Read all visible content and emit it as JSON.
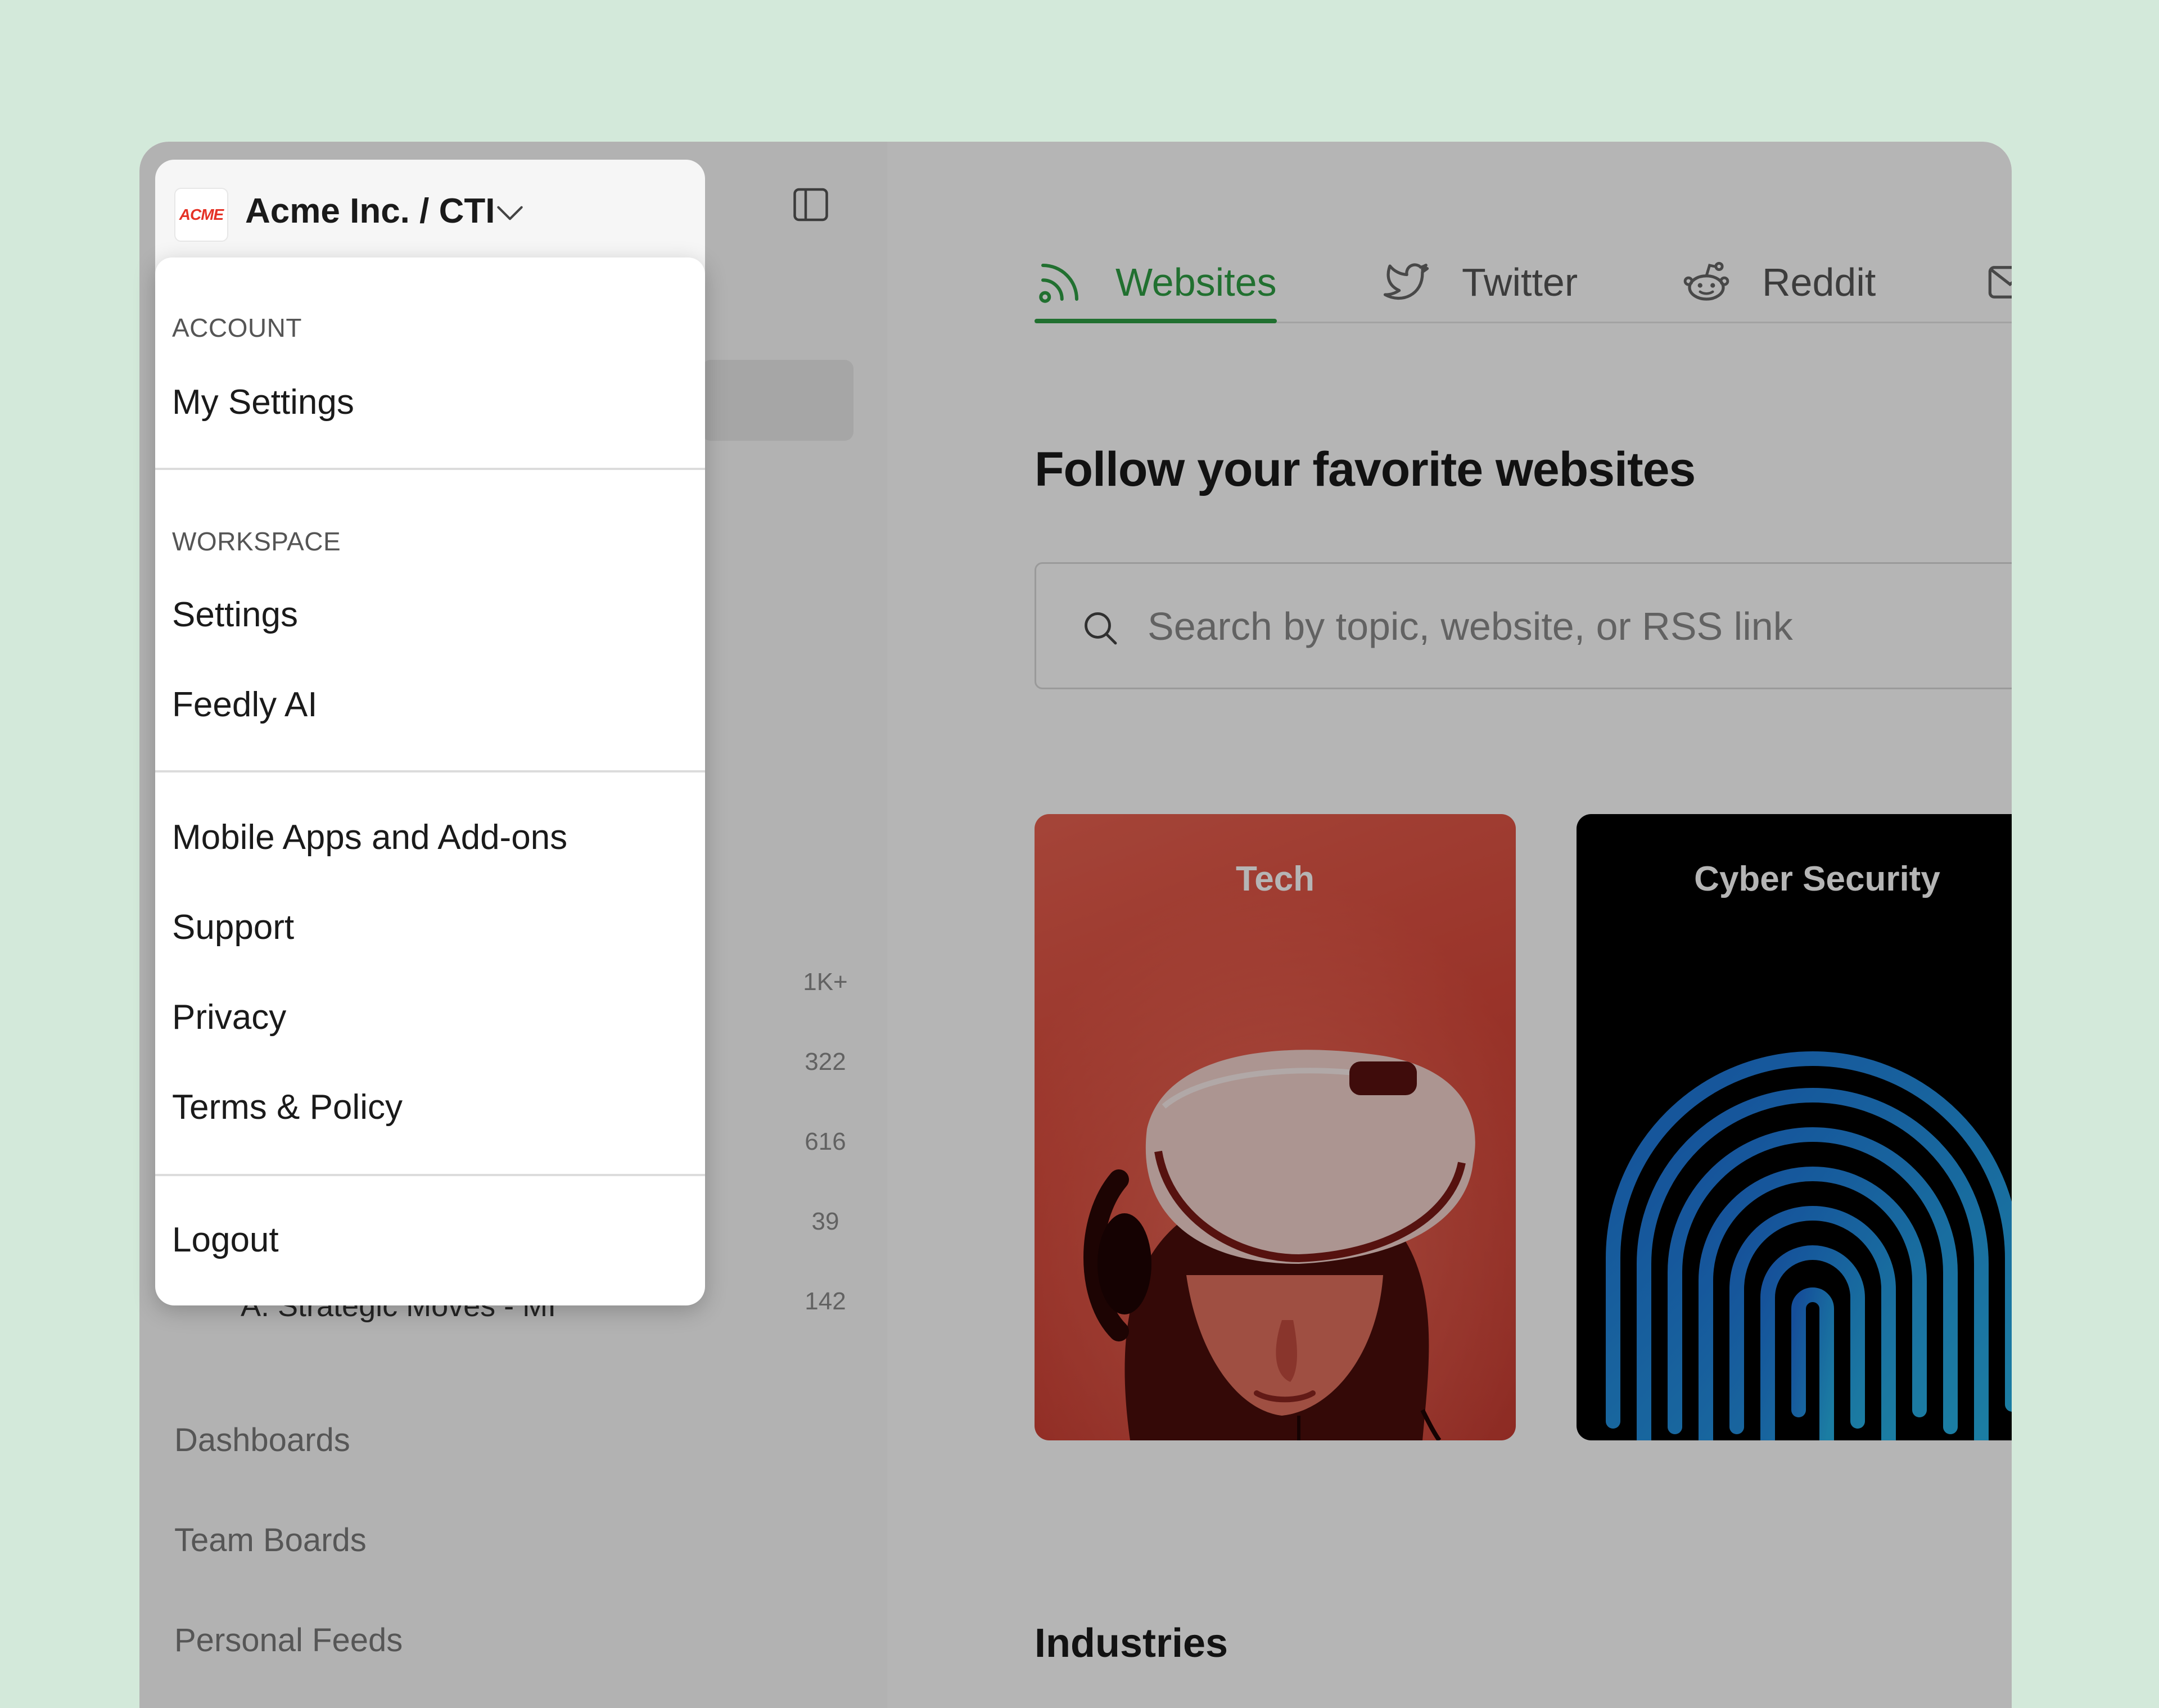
{
  "workspace": {
    "logo_text": "ACME",
    "name": "Acme Inc. / CTI"
  },
  "menu": {
    "account_label": "ACCOUNT",
    "my_settings": "My Settings",
    "workspace_label": "WORKSPACE",
    "settings": "Settings",
    "feedly_ai": "Feedly AI",
    "mobile_apps": "Mobile Apps and Add-ons",
    "support": "Support",
    "privacy": "Privacy",
    "terms": "Terms & Policy",
    "logout": "Logout"
  },
  "sidebar": {
    "feed_counts": [
      "1K+",
      "322",
      "616",
      "39",
      "142"
    ],
    "partial_feed_label": "A. Strategic Moves - MI",
    "sections": [
      "Dashboards",
      "Team Boards",
      "Personal Feeds"
    ]
  },
  "main": {
    "tabs": [
      {
        "label": "Websites",
        "icon": "rss-icon",
        "active": true
      },
      {
        "label": "Twitter",
        "icon": "twitter-icon",
        "active": false
      },
      {
        "label": "Reddit",
        "icon": "reddit-icon",
        "active": false
      },
      {
        "label": "",
        "icon": "newsletter-icon",
        "active": false
      }
    ],
    "heading": "Follow your favorite websites",
    "search_placeholder": "Search by topic, website, or RSS link",
    "cards": [
      {
        "title": "Tech",
        "image": "vr-headset-person"
      },
      {
        "title": "Cyber Security",
        "image": "fingerprint"
      }
    ],
    "industries_heading": "Industries"
  },
  "colors": {
    "accent_green": "#2f9e44",
    "acme_red": "#e53226",
    "page_background": "#d3e9da",
    "tech_card": "#d94a3a",
    "cyber_card": "#000000"
  }
}
